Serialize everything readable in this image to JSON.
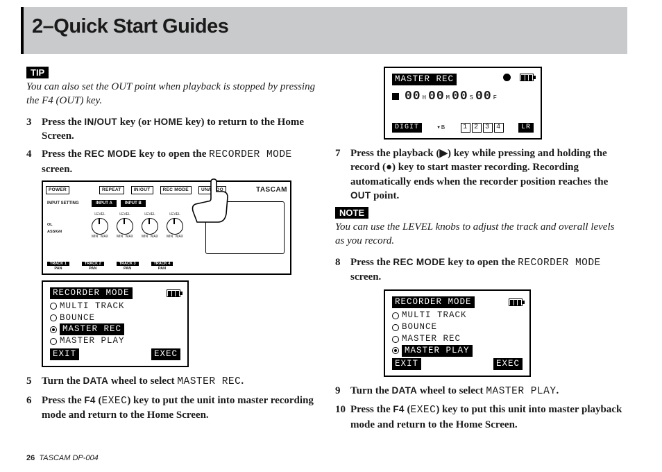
{
  "header": {
    "title": "2–Quick Start Guides"
  },
  "col1": {
    "tip_tag": "TIP",
    "tip_text": "You can also set the OUT point when playback is stopped by pressing the F4 (OUT) key.",
    "step3": {
      "n": "3",
      "a": "Press the ",
      "b": "IN/OUT",
      "c": " key (or ",
      "d": "HOME",
      "e": " key) to return to the Home Screen."
    },
    "step4": {
      "n": "4",
      "a": "Press the ",
      "b": "REC MODE",
      "c": " key to open the ",
      "d": "RECORDER MODE",
      "e": " screen."
    },
    "step5": {
      "n": "5",
      "a": "Turn the ",
      "b": "DATA",
      "c": " wheel to select ",
      "d": "MASTER REC",
      "e": "."
    },
    "step6": {
      "n": "6",
      "a": "Press the ",
      "b": "F4",
      "c": " (",
      "d": "EXEC",
      "e": ") key to put the unit into master recording mode and return to the Home Screen."
    }
  },
  "device": {
    "power": "POWER",
    "repeat": "REPEAT",
    "inout": "IN/OUT",
    "recmode": "REC MODE",
    "unredo": "UN/REDO",
    "brand": "TASCAM",
    "inputsetting": "INPUT SETTING",
    "inputa": "INPUT A",
    "inputb": "INPUT B",
    "ol": "OL",
    "level": "LEVEL",
    "assign": "ASSIGN",
    "min": "MIN",
    "max": "MAX",
    "track1": "TRACK 1",
    "track2": "TRACK 2",
    "track3": "TRACK 3",
    "track4": "TRACK 4",
    "pan": "PAN"
  },
  "lcd_recmode": {
    "title": "RECORDER MODE",
    "opt1": "MULTI TRACK",
    "opt2": "BOUNCE",
    "opt3": "MASTER REC",
    "opt4": "MASTER PLAY",
    "exit": "EXIT",
    "exec": "EXEC"
  },
  "col2": {
    "step7": {
      "n": "7",
      "a": "Press the playback (▶) key while pressing and holding the record (●) key to start master recording. Recording automatically ends when the recorder position reaches the ",
      "b": "OUT",
      "c": " point."
    },
    "note_tag": "NOTE",
    "note_text": "You can use the LEVEL knobs to adjust the track and overall levels as you record.",
    "step8": {
      "n": "8",
      "a": "Press the ",
      "b": "REC MODE",
      "c": " key to open the ",
      "d": "RECORDER MODE",
      "e": " screen."
    },
    "step9": {
      "n": "9",
      "a": "Turn the ",
      "b": "DATA",
      "c": " wheel to select ",
      "d": "MASTER PLAY",
      "e": "."
    },
    "step10": {
      "n": "10",
      "a": "Press the ",
      "b": "F4",
      "c": " (",
      "d": "EXEC",
      "e": ") key to put this unit into master playback mode and return to the Home Screen."
    }
  },
  "lcd_master": {
    "title": "MASTER REC",
    "h": "00",
    "hU": "H",
    "m": "00",
    "mU": "M",
    "s": "00",
    "sU": "S",
    "f": "00",
    "fU": "F",
    "digit": "DIGIT",
    "cur": "▾B",
    "c1": "1",
    "c2": "2",
    "c3": "3",
    "c4": "4",
    "lr": "LR"
  },
  "footer": {
    "page": "26",
    "model": "TASCAM  DP-004"
  }
}
